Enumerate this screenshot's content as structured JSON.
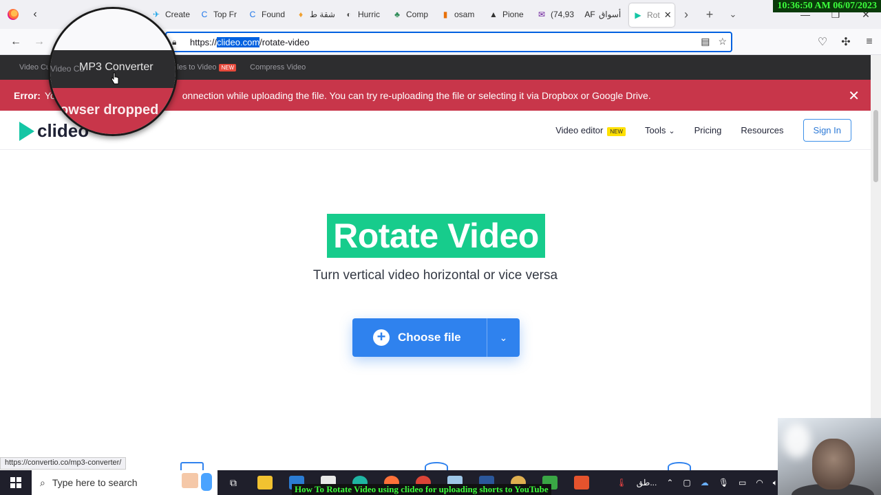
{
  "browser": {
    "clock": "10:36:50 AM 06/07/2023",
    "tabs": [
      {
        "label": "Create",
        "color": "#1aa3e8",
        "glyph": "✈"
      },
      {
        "label": "Top Fr",
        "color": "#1a73e8",
        "glyph": "C"
      },
      {
        "label": "Found",
        "color": "#1a73e8",
        "glyph": "C"
      },
      {
        "label": "شقة ط",
        "color": "#f0a030",
        "glyph": "♦"
      },
      {
        "label": "Hurric",
        "color": "#555",
        "glyph": "◐"
      },
      {
        "label": "Comp",
        "color": "#2e8b57",
        "glyph": "♣"
      },
      {
        "label": "osam",
        "color": "#e8710a",
        "glyph": "▮"
      },
      {
        "label": "Pione",
        "color": "#333",
        "glyph": "▲"
      },
      {
        "label": "(74,93",
        "color": "#6a1b9a",
        "glyph": "✉"
      },
      {
        "label": "أسواق",
        "color": "#222",
        "glyph": "AF"
      }
    ],
    "active_tab": {
      "label": "Rot",
      "color": "#14c6a5"
    },
    "url_prefix": "https://",
    "url_selected": "clideo.com",
    "url_suffix": "/rotate-video",
    "status_url": "https://convertio.co/mp3-converter/"
  },
  "site_topbar": {
    "items": [
      "Video Cutter",
      "MP3 Converter",
      "Subtitles to Video",
      "Compress Video"
    ],
    "visible": [
      "Video Cu",
      "Subtitles to Video",
      "Compress Video"
    ],
    "new_badge": "NEW"
  },
  "error": {
    "label": "Error:",
    "message": "Your browser dropped connection while uploading the file. You can try re-uploading the file or selecting it via Dropbox or Google Drive.",
    "visible_message": "Yo",
    "visible_tail": "onnection while uploading the file. You can try re-uploading the file or selecting it via Dropbox or Google Drive."
  },
  "header": {
    "logo": "clideo",
    "menu": {
      "video_editor": "Video editor",
      "new_badge": "NEW",
      "tools": "Tools",
      "pricing": "Pricing",
      "resources": "Resources",
      "sign_in": "Sign In"
    }
  },
  "hero": {
    "title": "Rotate Video",
    "subtitle": "Turn vertical video horizontal or vice versa",
    "choose_file": "Choose file"
  },
  "magnifier": {
    "zoom_text": "MP3 Converter",
    "zoom_sub": "owser dropped",
    "zoom_left": "Video Cu"
  },
  "taskbar": {
    "search_placeholder": "Type here to search",
    "tray_lang": "طق..."
  },
  "video_caption": "How To Rotate Video using clideo for uploading shorts to YouTube"
}
